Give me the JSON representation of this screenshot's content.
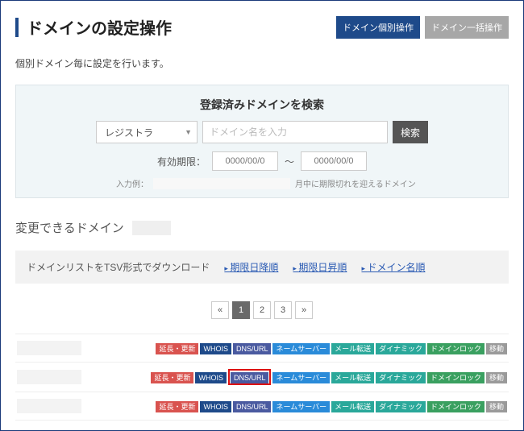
{
  "header": {
    "title": "ドメインの設定操作",
    "btn_indiv": "ドメイン個別操作",
    "btn_bulk": "ドメイン一括操作"
  },
  "lead": "個別ドメイン毎に設定を行います。",
  "search": {
    "title": "登録済みドメインを検索",
    "registrar_label": "レジストラ",
    "domain_placeholder": "ドメイン名を入力",
    "button": "検索",
    "expiry_label": "有効期限：",
    "date_placeholder": "0000/00/0",
    "tilde": "～",
    "hint_label": "入力例：",
    "hint_tail": "月中に期限切れを迎えるドメイン"
  },
  "section": {
    "label": "変更できるドメイン"
  },
  "download_bar": {
    "label": "ドメインリストをTSV形式でダウンロード",
    "sort_desc": "期限日降順",
    "sort_asc": "期限日昇順",
    "sort_name": "ドメイン名順"
  },
  "pager": {
    "prev": "«",
    "pages": [
      "1",
      "2",
      "3"
    ],
    "next": "»",
    "current": 0
  },
  "tag_defs": [
    {
      "key": "renew",
      "label": "延長・更新",
      "color": "#d9534f"
    },
    {
      "key": "whois",
      "label": "WHOIS",
      "color": "#1e4a8a"
    },
    {
      "key": "dnsurl",
      "label": "DNS/URL",
      "color": "#4a5aa0"
    },
    {
      "key": "ns",
      "label": "ネームサーバー",
      "color": "#2a8bd9"
    },
    {
      "key": "mailfw",
      "label": "メール転送",
      "color": "#2aa89a"
    },
    {
      "key": "dyn",
      "label": "ダイナミック",
      "color": "#2aa89a"
    },
    {
      "key": "lock",
      "label": "ドメインロック",
      "color": "#3aa060"
    },
    {
      "key": "move",
      "label": "移動",
      "color": "#9a9a9a"
    }
  ],
  "rows": [
    {
      "highlight": null
    },
    {
      "highlight": "dnsurl"
    },
    {
      "highlight": null
    }
  ]
}
